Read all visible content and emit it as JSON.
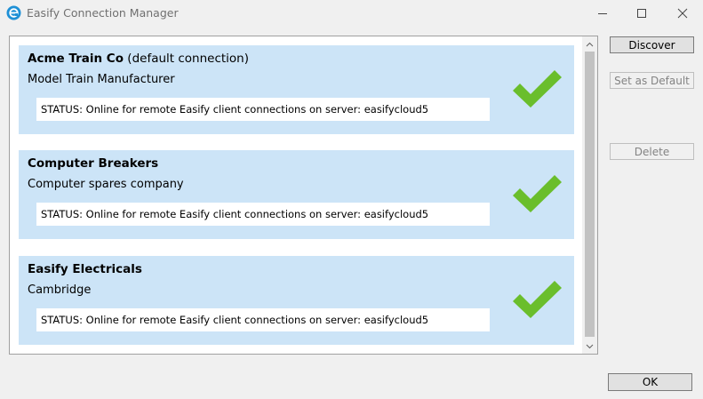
{
  "window": {
    "title": "Easify Connection Manager",
    "icon": "easify-logo-icon",
    "controls": [
      "minimize-icon",
      "maximize-icon",
      "close-icon"
    ]
  },
  "connections": [
    {
      "name": "Acme Train Co",
      "note": "(default connection)",
      "description": "Model Train Manufacturer",
      "status": "STATUS: Online for remote Easify client connections on server: easifycloud5",
      "status_icon": "check-icon"
    },
    {
      "name": "Computer Breakers",
      "note": "",
      "description": "Computer spares company",
      "status": "STATUS: Online for remote Easify client connections on server: easifycloud5",
      "status_icon": "check-icon"
    },
    {
      "name": "Easify Electricals",
      "note": "",
      "description": "Cambridge",
      "status": "STATUS: Online for remote Easify client connections on server: easifycloud5",
      "status_icon": "check-icon"
    }
  ],
  "buttons": {
    "discover": "Discover",
    "set_default": "Set as Default",
    "delete": "Delete",
    "ok": "OK"
  },
  "colors": {
    "card_background": "#cce4f7",
    "check_green": "#6abe2c",
    "app_icon_blue": "#1e90d6"
  }
}
